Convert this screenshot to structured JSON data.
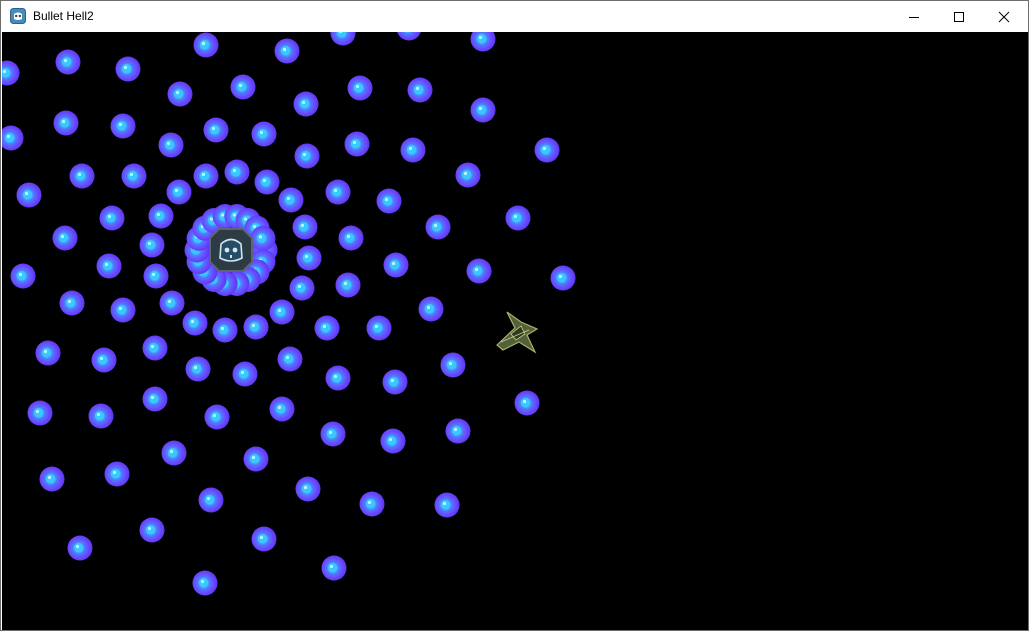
{
  "window": {
    "title": "Bullet Hell2",
    "app_icon": "godot-icon",
    "controls": [
      "minimize-icon",
      "maximize-icon",
      "close-icon"
    ]
  },
  "game": {
    "background_color": "#000000",
    "bullet_color": "#6b46ff",
    "bullet_core_color": "#39c8ff",
    "boss_icon": "godot-icon",
    "player_icon": "spaceship-icon"
  }
}
